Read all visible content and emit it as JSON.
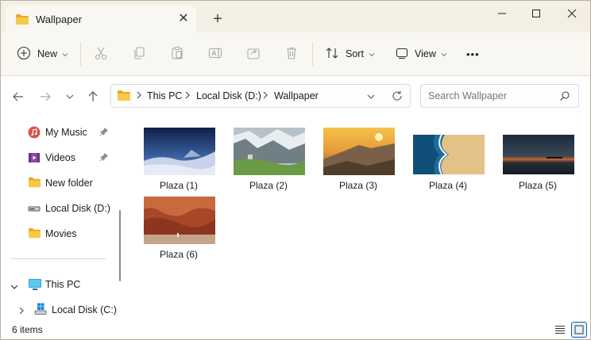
{
  "tab": {
    "title": "Wallpaper",
    "close": "✕",
    "new_tab": "+"
  },
  "window_controls": {
    "minimize": "minimize",
    "maximize": "maximize",
    "close": "close"
  },
  "toolbar": {
    "new_label": "New",
    "sort_label": "Sort",
    "view_label": "View",
    "more_label": "•••"
  },
  "address": {
    "crumbs": [
      "This PC",
      "Local Disk (D:)",
      "Wallpaper"
    ],
    "sep": ">"
  },
  "search": {
    "placeholder": "Search Wallpaper"
  },
  "sidebar": {
    "items": [
      {
        "label": "My Music",
        "icon": "music-folder-icon",
        "pinned": true
      },
      {
        "label": "Videos",
        "icon": "videos-folder-icon",
        "pinned": true
      },
      {
        "label": "New folder",
        "icon": "folder-icon",
        "pinned": false
      },
      {
        "label": "Local Disk (D:)",
        "icon": "drive-icon",
        "pinned": false
      },
      {
        "label": "Movies",
        "icon": "folder-icon",
        "pinned": false
      }
    ],
    "tree": [
      {
        "label": "This PC",
        "icon": "pc-icon",
        "expanded": true
      },
      {
        "label": "Local Disk (C:)",
        "icon": "windows-drive-icon",
        "expanded": false
      }
    ]
  },
  "files": [
    {
      "name": "Plaza (1)"
    },
    {
      "name": "Plaza (2)"
    },
    {
      "name": "Plaza (3)"
    },
    {
      "name": "Plaza (4)"
    },
    {
      "name": "Plaza (5)"
    },
    {
      "name": "Plaza (6)"
    }
  ],
  "status": {
    "item_count": "6 items"
  },
  "colors": {
    "folder": "#f2c14e",
    "accent": "#005fb8",
    "titlebar": "#f3efe4"
  }
}
